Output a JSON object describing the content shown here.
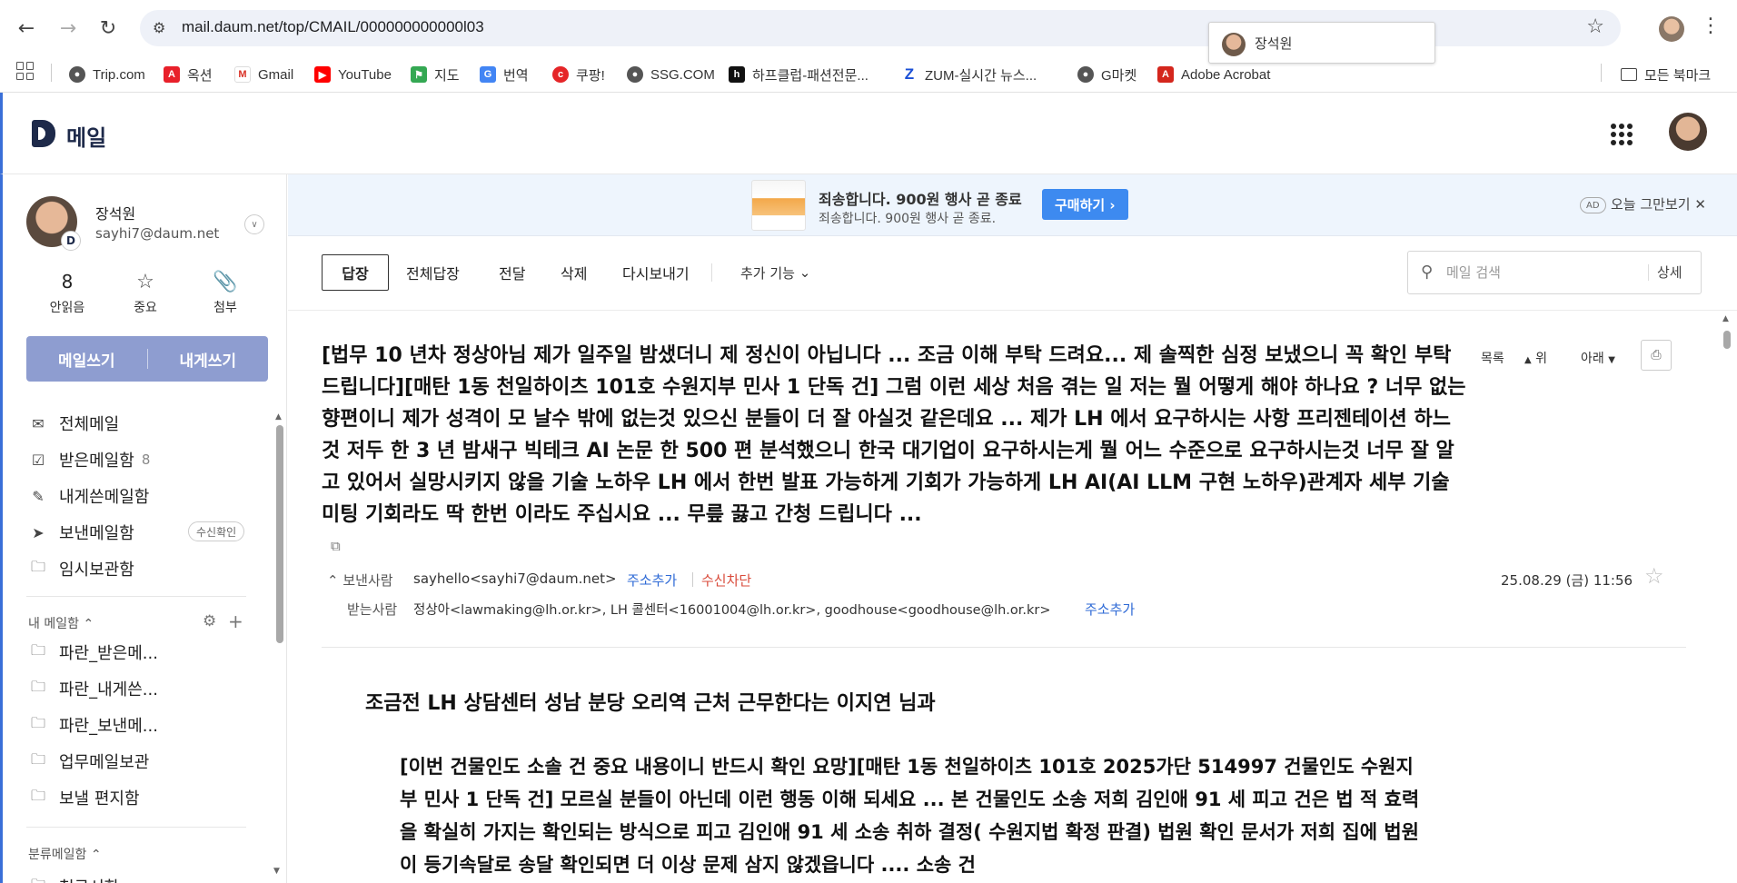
{
  "browser": {
    "url": "mail.daum.net/top/CMAIL/000000000000l03",
    "profile_name": "장석원",
    "bookmarks": [
      {
        "label": "Trip.com",
        "icon": "trip-icon",
        "color": "#555555"
      },
      {
        "label": "옥션",
        "icon": "auction-icon",
        "color": "#e8202a"
      },
      {
        "label": "Gmail",
        "icon": "gmail-icon",
        "color": "#d93025"
      },
      {
        "label": "YouTube",
        "icon": "youtube-icon",
        "color": "#ff0000"
      },
      {
        "label": "지도",
        "icon": "maps-icon",
        "color": "#34a853"
      },
      {
        "label": "번역",
        "icon": "translate-icon",
        "color": "#4285f4"
      },
      {
        "label": "쿠팡!",
        "icon": "coupang-icon",
        "color": "#e52528"
      },
      {
        "label": "SSG.COM",
        "icon": "ssg-icon",
        "color": "#555555"
      },
      {
        "label": "하프클럽-패션전문...",
        "icon": "halfclub-icon",
        "color": "#111111"
      },
      {
        "label": "ZUM-실시간 뉴스...",
        "icon": "zum-icon",
        "color": "#1a4fd6"
      },
      {
        "label": "G마켓",
        "icon": "gmarket-icon",
        "color": "#555555"
      },
      {
        "label": "Adobe Acrobat",
        "icon": "acrobat-icon",
        "color": "#d4261d"
      }
    ],
    "all_bookmarks": "모든 북마크"
  },
  "mail_app": {
    "logo_text": "메일",
    "user": {
      "name": "장석원",
      "email": "sayhi7@daum.net",
      "badge": "D"
    },
    "stats": [
      {
        "value": "8",
        "label": "안읽음"
      },
      {
        "icon": "star-icon",
        "label": "중요"
      },
      {
        "icon": "paperclip-icon",
        "label": "첨부"
      }
    ],
    "compose": {
      "write": "메일쓰기",
      "to_self": "내게쓰기"
    },
    "folders": [
      {
        "label": "전체메일",
        "icon": "mail-icon",
        "count": ""
      },
      {
        "label": "받은메일함",
        "icon": "inbox-icon",
        "count": "8"
      },
      {
        "label": "내게쓴메일함",
        "icon": "note-icon",
        "count": ""
      },
      {
        "label": "보낸메일함",
        "icon": "send-icon",
        "count": "",
        "badge": "수신확인"
      },
      {
        "label": "임시보관함",
        "icon": "folder-icon",
        "count": ""
      }
    ],
    "my_mailbox_title": "내 메일함",
    "my_folders": [
      "파란_받은메...",
      "파란_내게쓴...",
      "파란_보낸메...",
      "업무메일보관",
      "보낼 편지함"
    ],
    "category_title": "분류메일함",
    "category_first": "청구서함"
  },
  "ad": {
    "title": "죄송합니다. 900원 행사 곧 종료",
    "subtitle": "죄송합니다. 900원 행사 곧 종료.",
    "button": "구매하기 ›",
    "tag": "AD",
    "close_label": "오늘 그만보기"
  },
  "toolbar": {
    "reply": "답장",
    "reply_all": "전체답장",
    "forward": "전달",
    "delete": "삭제",
    "resend": "다시보내기",
    "more": "추가 기능",
    "search_placeholder": "메일 검색",
    "search_detail": "상세"
  },
  "message": {
    "subject": "[법무 10 년차 정상아님 제가 일주일 밤샜더니 제 정신이 아닙니다 ... 조금 이해 부탁 드려요... 제 솔찍한 심정 보냈으니 꼭 확인 부탁드립니다][매탄 1동 천일하이츠 101호 수원지부 민사 1 단독 건] 그럼 이런 세상 처음 겪는 일 저는 뭘 어떻게 해야 하나요 ? 너무 없는 향편이니 제가 성격이 모 날수 밖에 없는것 있으신 분들이 더 잘 아실것 같은데요 ... 제가 LH 에서 요구하시는 사항 프리젠테이션 하느것 저두 한 3 년 밤새구 빅테크 AI 논문 한 500 편 분석했으니 한국 대기업이 요구하시는게 뭘 어느 수준으로 요구하시는것 너무 잘 알고 있어서 실망시키지 않을 기술 노하우 LH 에서 한번 발표 가능하게 기회가 가능하게 LH AI(AI LLM 구현 노하우)관계자 세부 기술 미팅 기회라도 딱 한번 이라도 주십시요 ... 무릎 끓고 간청 드립니다 ...",
    "nav": {
      "list": "목록",
      "up": "위",
      "down": "아래"
    },
    "sender_label": "보낸사람",
    "sender": "sayhello<sayhi7@daum.net>",
    "add_address": "주소추가",
    "block": "수신차단",
    "date": "25.08.29 (금) 11:56",
    "recipients_label": "받는사람",
    "recipients": "정상아<lawmaking@lh.or.kr>, LH 콜센터<16001004@lh.or.kr>, goodhouse<goodhouse@lh.or.kr>",
    "add_address_2": "주소추가",
    "greeting": "조금전 LH 상담센터 성남 분당 오리역 근처 근무한다는 이지연 님과",
    "paragraph": "[이번 건물인도 소솔 건 중요 내용이니 반드시 확인 요망][매탄 1동 천일하이츠 101호 2025가단 514997 건물인도 수원지부 민사 1 단독 건] 모르실 분들이 아닌데 이런 행동 이해 되세요 ... 본 건물인도 소송 저희 김인애 91 세 피고 건은 법 적 효력을 확실히 가지는 확인되는 방식으로 피고 김인애 91 세 소송 취하 결정( 수원지법 확정 판결) 법원 확인 문서가 저희 집에 법원이 등기속달로 송달 확인되면 더 이상 문제 삼지 않겠읍니다 .... 소송 건"
  },
  "colors": {
    "accent": "#3a6fd8",
    "compose_bg": "#8e9dd0",
    "link": "#2e6ad6",
    "block_red": "#d94a3a",
    "ad_bg": "#eef5fd",
    "buy_button": "#3d8af0"
  }
}
